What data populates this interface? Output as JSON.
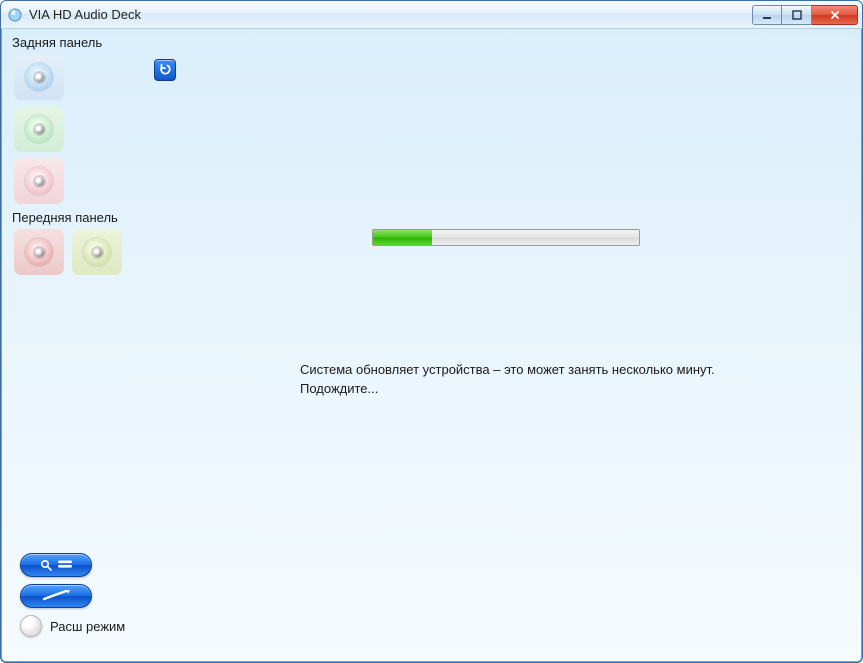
{
  "title": "VIA HD Audio Deck",
  "rear_panel_label": "Задняя панель",
  "front_panel_label": "Передняя панель",
  "progress_percent": 22,
  "message": "Система  обновляет  устройства – это может занять несколько минут.\nПодождите...",
  "mode_label": "Расш режим",
  "icons": {
    "reset": "reset-icon",
    "settings": "settings-icon",
    "info": "info-icon"
  }
}
